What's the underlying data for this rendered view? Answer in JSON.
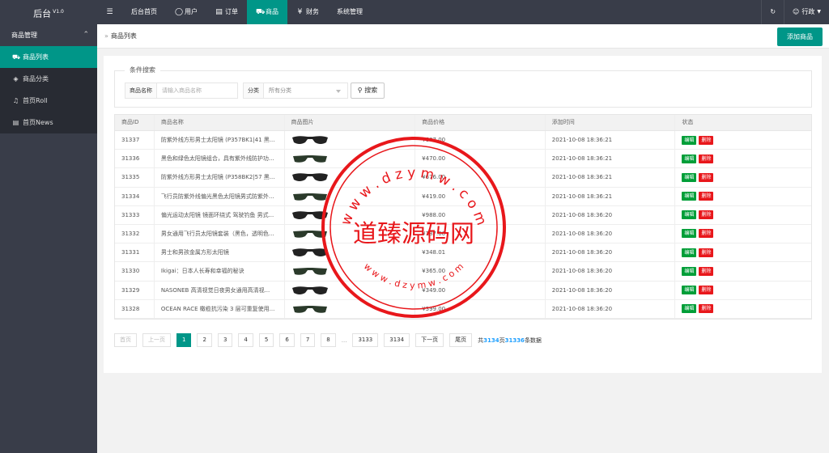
{
  "app": {
    "logo": "后台",
    "version": "V1.0"
  },
  "topnav": [
    {
      "label": "",
      "icon": "menu-icon"
    },
    {
      "label": "后台首页",
      "icon": ""
    },
    {
      "label": "用户",
      "icon": "user-icon"
    },
    {
      "label": "订单",
      "icon": "order-icon"
    },
    {
      "label": "商品",
      "icon": "cart-icon",
      "active": true
    },
    {
      "label": "财务",
      "icon": "yen-icon"
    },
    {
      "label": "系统管理",
      "icon": ""
    }
  ],
  "topright": {
    "refresh_icon": "refresh-icon",
    "user_label": "行政"
  },
  "sidebar": {
    "group_label": "商品管理",
    "items": [
      {
        "label": "商品列表",
        "icon": "cart-icon",
        "active": true
      },
      {
        "label": "商品分类",
        "icon": "layers-icon"
      },
      {
        "label": "首页Roll",
        "icon": "bell-icon"
      },
      {
        "label": "首页News",
        "icon": "news-icon"
      }
    ]
  },
  "breadcrumb": {
    "current": "商品列表"
  },
  "toolbar": {
    "add_label": "添加商品"
  },
  "filter": {
    "legend": "条件搜索",
    "name_label": "商品名称",
    "name_placeholder": "请输入商品名称",
    "category_label": "分类",
    "category_value": "所有分类",
    "search_label": "搜索"
  },
  "table": {
    "headers": [
      "商品ID",
      "商品名称",
      "商品图片",
      "商品价格",
      "添加时间",
      "状态"
    ],
    "edit_label": "编辑",
    "delete_label": "删除",
    "rows": [
      {
        "id": "31337",
        "name": "防紫外线方形男士太阳镜 (P357BK1|41 黑...",
        "price": "¥607.00",
        "time": "2021-10-08 18:36:21"
      },
      {
        "id": "31336",
        "name": "黑色和绿色太阳镜组合，具有紫外线防护功...",
        "price": "¥470.00",
        "time": "2021-10-08 18:36:21"
      },
      {
        "id": "31335",
        "name": "防紫外线方形男士太阳镜 (P358BK2|57 黑...",
        "price": "¥676.00",
        "time": "2021-10-08 18:36:21"
      },
      {
        "id": "31334",
        "name": "飞行员防紫外线偏光黑色太阳镜男式防紫外...",
        "price": "¥419.00",
        "time": "2021-10-08 18:36:21"
      },
      {
        "id": "31333",
        "name": "偏光运动太阳镜 镜面环绕式 驾驶钓鱼 男式...",
        "price": "¥988.00",
        "time": "2021-10-08 18:36:20"
      },
      {
        "id": "31332",
        "name": "男女通用飞行员太阳镜套装（黑色，透明色...",
        "price": "¥187.00",
        "time": "2021-10-08 18:36:20"
      },
      {
        "id": "31331",
        "name": "男士和男孩金属方形太阳镜",
        "price": "¥348.01",
        "time": "2021-10-08 18:36:20"
      },
      {
        "id": "31330",
        "name": "Ikigai：日本人长寿和幸福的秘诀",
        "price": "¥365.00",
        "time": "2021-10-08 18:36:20"
      },
      {
        "id": "31329",
        "name": "NASONEB 高清视觉日夜男女通用高清视...",
        "price": "¥349.00",
        "time": "2021-10-08 18:36:20"
      },
      {
        "id": "31328",
        "name": "OCEAN RACE 橄榄抗污染 3 层可重复使用...",
        "price": "¥399.00",
        "time": "2021-10-08 18:36:20"
      }
    ]
  },
  "pager": {
    "first": "首页",
    "prev": "上一页",
    "pages": [
      "1",
      "2",
      "3",
      "4",
      "5",
      "6",
      "7",
      "8"
    ],
    "ellipsis": "...",
    "tail_pages": [
      "3133",
      "3134"
    ],
    "next": "下一页",
    "last": "尾页",
    "total_prefix": "共",
    "total_pages": "3134",
    "total_mid": "页",
    "total_records": "31336",
    "total_suffix": "条数据"
  },
  "watermark": {
    "text_cn": "道臻源码网",
    "text_top": "w w w . d z y m w . c o m",
    "text_bottom": "w w w . d z y m w . c o m",
    "color": "#e8171b"
  }
}
